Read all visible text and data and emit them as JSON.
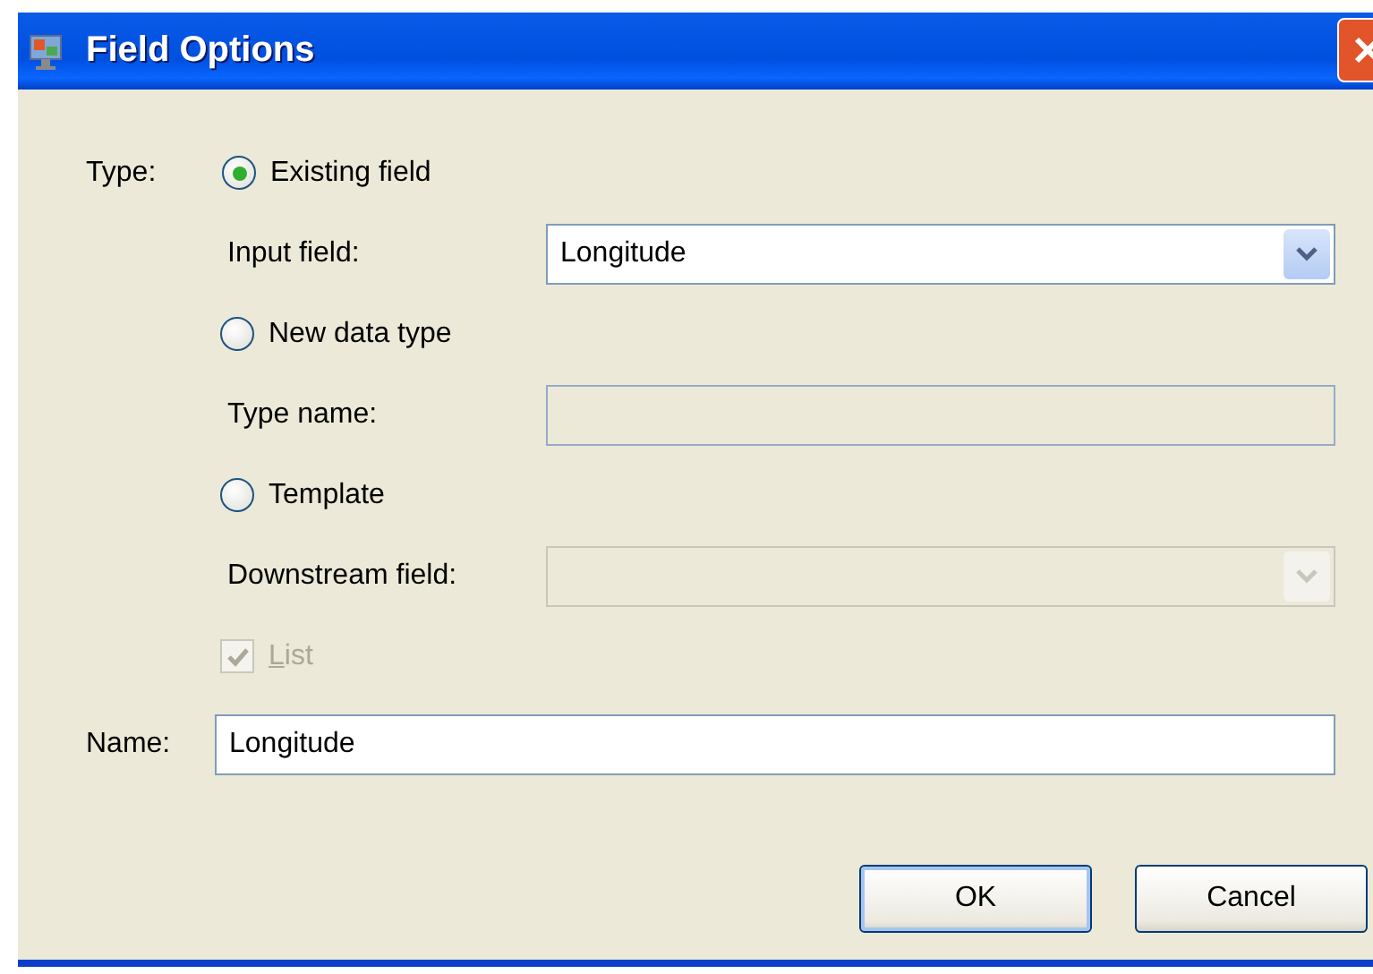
{
  "window": {
    "title": "Field Options"
  },
  "type_label": "Type:",
  "options": [
    {
      "label": "Existing field",
      "selected": true
    },
    {
      "label": "New data type",
      "selected": false
    },
    {
      "label": "Template",
      "selected": false
    }
  ],
  "input_field": {
    "label": "Input field:",
    "value": "Longitude",
    "disabled": false
  },
  "type_name": {
    "label": "Type name:",
    "disabled": true
  },
  "downstream_field": {
    "label": "Downstream field:",
    "disabled": true
  },
  "list_checkbox": {
    "label": "List",
    "checked": true,
    "disabled": true
  },
  "name": {
    "label": "Name:",
    "value": "Longitude"
  },
  "buttons": [
    {
      "label": "OK",
      "default": true
    },
    {
      "label": "Cancel",
      "default": false
    }
  ]
}
